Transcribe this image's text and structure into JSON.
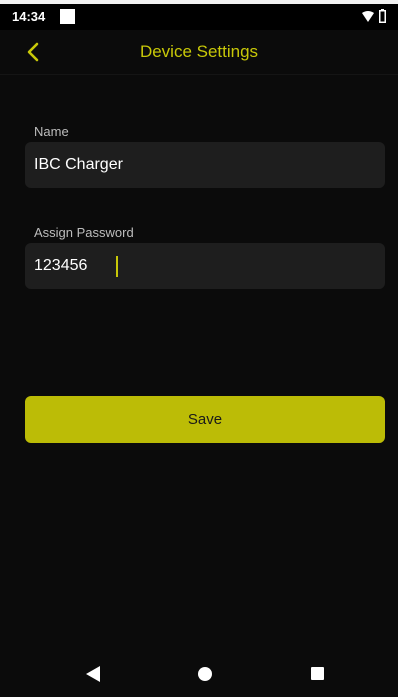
{
  "status_bar": {
    "time": "14:34"
  },
  "header": {
    "title": "Device Settings",
    "back_icon": "chevron-left-icon"
  },
  "form": {
    "name": {
      "label": "Name",
      "value": "IBC Charger"
    },
    "password": {
      "label": "Assign Password",
      "value": "123456"
    },
    "save_label": "Save"
  },
  "colors": {
    "accent": "#c8c808",
    "button": "#bcbc06",
    "field": "#1e1e1e",
    "background": "#0b0b0b"
  },
  "nav_bar": {
    "icons": [
      "nav-back-icon",
      "nav-home-icon",
      "nav-recents-icon"
    ]
  }
}
